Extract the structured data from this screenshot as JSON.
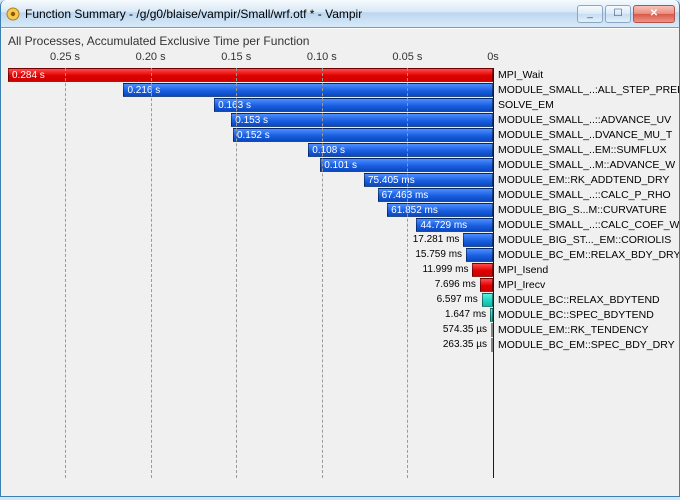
{
  "window": {
    "title": "Function Summary - /g/g0/blaise/vampir/Small/wrf.otf * - Vampir",
    "minimize_label": "_",
    "maximize_label": "☐",
    "close_label": "✕"
  },
  "description": "All Processes, Accumulated Exclusive Time per Function",
  "axis": {
    "ticks": [
      {
        "pos": 0.1176,
        "label": "0.25 s"
      },
      {
        "pos": 0.2941,
        "label": "0.20 s"
      },
      {
        "pos": 0.4706,
        "label": "0.15 s"
      },
      {
        "pos": 0.6471,
        "label": "0.10 s"
      },
      {
        "pos": 0.8235,
        "label": "0.05 s"
      },
      {
        "pos": 1.0,
        "label": "0s"
      }
    ]
  },
  "chart_data": {
    "type": "bar",
    "orientation": "horizontal-right-zero",
    "title": "All Processes, Accumulated Exclusive Time per Function",
    "xlabel": "Accumulated Exclusive Time",
    "ylabel": "",
    "xlim_seconds": [
      0,
      0.2835
    ],
    "series": [
      {
        "func": "MPI_Wait",
        "time_s": 0.284,
        "label": "0.284 s",
        "color": "red",
        "lbl_inside": true
      },
      {
        "func": "MODULE_SMALL_..:ALL_STEP_PREP",
        "time_s": 0.216,
        "label": "0.216 s",
        "color": "blue",
        "lbl_inside": true
      },
      {
        "func": "SOLVE_EM",
        "time_s": 0.163,
        "label": "0.163 s",
        "color": "blue",
        "lbl_inside": true
      },
      {
        "func": "MODULE_SMALL_..::ADVANCE_UV",
        "time_s": 0.153,
        "label": "0.153 s",
        "color": "blue",
        "lbl_inside": true
      },
      {
        "func": "MODULE_SMALL_..DVANCE_MU_T",
        "time_s": 0.152,
        "label": "0.152 s",
        "color": "blue",
        "lbl_inside": true
      },
      {
        "func": "MODULE_SMALL_..EM::SUMFLUX",
        "time_s": 0.108,
        "label": "0.108 s",
        "color": "blue",
        "lbl_inside": true
      },
      {
        "func": "MODULE_SMALL_..M::ADVANCE_W",
        "time_s": 0.101,
        "label": "0.101 s",
        "color": "blue",
        "lbl_inside": true
      },
      {
        "func": "MODULE_EM::RK_ADDTEND_DRY",
        "time_s": 0.075405,
        "label": "75.405 ms",
        "color": "blue",
        "lbl_inside": true
      },
      {
        "func": "MODULE_SMALL_..::CALC_P_RHO",
        "time_s": 0.067463,
        "label": "67.463 ms",
        "color": "blue",
        "lbl_inside": true
      },
      {
        "func": "MODULE_BIG_S...M::CURVATURE",
        "time_s": 0.061852,
        "label": "61.852 ms",
        "color": "blue",
        "lbl_inside": true
      },
      {
        "func": "MODULE_SMALL_..::CALC_COEF_W",
        "time_s": 0.044729,
        "label": "44.729 ms",
        "color": "blue",
        "lbl_inside": true
      },
      {
        "func": "MODULE_BIG_ST..._EM::CORIOLIS",
        "time_s": 0.017281,
        "label": "17.281 ms",
        "color": "blue",
        "lbl_inside": false
      },
      {
        "func": "MODULE_BC_EM::RELAX_BDY_DRY",
        "time_s": 0.015759,
        "label": "15.759 ms",
        "color": "blue",
        "lbl_inside": false
      },
      {
        "func": "MPI_Isend",
        "time_s": 0.011999,
        "label": "11.999 ms",
        "color": "red",
        "lbl_inside": false
      },
      {
        "func": "MPI_Irecv",
        "time_s": 0.007696,
        "label": "7.696 ms",
        "color": "red",
        "lbl_inside": false
      },
      {
        "func": "MODULE_BC::RELAX_BDYTEND",
        "time_s": 0.006597,
        "label": "6.597 ms",
        "color": "cyan",
        "lbl_inside": false
      },
      {
        "func": "MODULE_BC::SPEC_BDYTEND",
        "time_s": 0.001647,
        "label": "1.647 ms",
        "color": "cyan",
        "lbl_inside": false
      },
      {
        "func": "MODULE_EM::RK_TENDENCY",
        "time_s": 0.00057435,
        "label": "574.35 µs",
        "color": "blue",
        "lbl_inside": false
      },
      {
        "func": "MODULE_BC_EM::SPEC_BDY_DRY",
        "time_s": 0.00026335,
        "label": "263.35 µs",
        "color": "blue",
        "lbl_inside": false
      }
    ]
  },
  "geom": {
    "zero_x": 491,
    "full_width": 485,
    "bar_max_s": 0.2835
  }
}
